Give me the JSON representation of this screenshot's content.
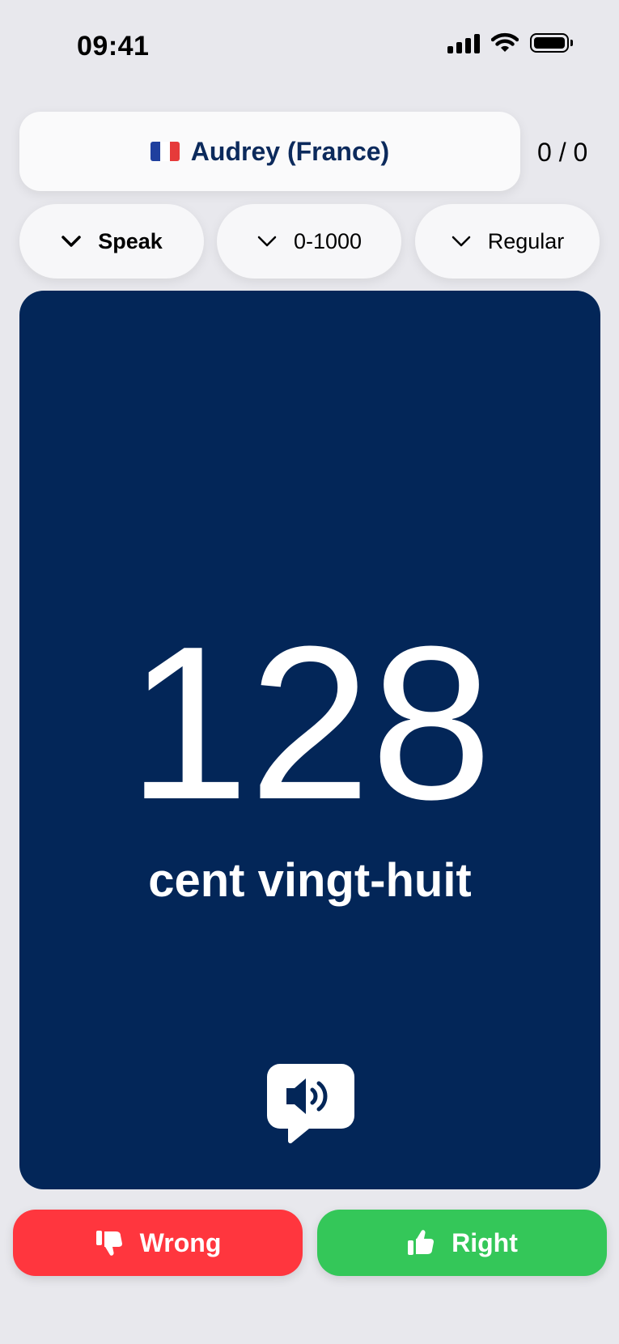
{
  "status_bar": {
    "time": "09:41"
  },
  "voice": {
    "flag_icon": "france-flag-icon",
    "label": "Audrey (France)"
  },
  "score": "0 / 0",
  "filters": [
    {
      "label": "Speak",
      "icon": "chevron-down-icon"
    },
    {
      "label": "0-1000",
      "icon": "chevron-down-icon"
    },
    {
      "label": "Regular",
      "icon": "chevron-down-icon"
    }
  ],
  "card": {
    "number": "128",
    "words": "cent vingt-huit",
    "speak_icon": "speaker-bubble-icon"
  },
  "actions": {
    "wrong": {
      "label": "Wrong",
      "icon": "thumbs-down-icon"
    },
    "right": {
      "label": "Right",
      "icon": "thumbs-up-icon"
    }
  },
  "colors": {
    "card_bg": "#032658",
    "wrong_bg": "#ff363e",
    "right_bg": "#34c759",
    "voice_text": "#0c2a5c",
    "page_bg": "#e8e8ed"
  }
}
